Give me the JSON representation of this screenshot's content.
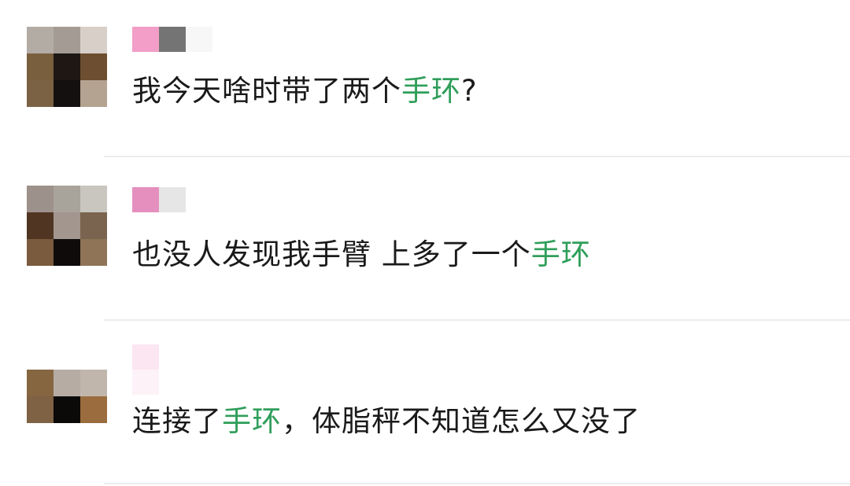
{
  "comments": [
    {
      "text_pre": "我今天啥时带了两个",
      "keyword": "手环",
      "text_post": "?",
      "avatar_colors": [
        "#b3aca5",
        "#a49b94",
        "#d8cfc8",
        "#7a5f3f",
        "#1e1714",
        "#6e4e30",
        "#7c6244",
        "#141010",
        "#b4a390"
      ],
      "name_colors": [
        "#f29ec8",
        "#747474",
        "#f7f7f7",
        "#ffffff"
      ]
    },
    {
      "text_pre": "也没人发现我手臂 上多了一个",
      "keyword": "手环",
      "text_post": "",
      "avatar_colors": [
        "#9d918b",
        "#a8a49b",
        "#c9c6bf",
        "#4f3522",
        "#a3968f",
        "#7a6450",
        "#7b5b3e",
        "#0e0b0a",
        "#8f7457"
      ],
      "name_colors": [
        "#e58fbe",
        "#e6e6e6"
      ]
    },
    {
      "text_pre": "连接了",
      "keyword": "手环",
      "text_post": "，体脂秤不知道怎么又没了",
      "avatar_colors": [
        "#866640",
        "#b6aca4",
        "#c1b6ac",
        "#7f6144",
        "#0c0a09",
        "#9a6c3e"
      ],
      "name_colors": [
        "#fbe6f1",
        "#fdf2f7"
      ]
    }
  ]
}
